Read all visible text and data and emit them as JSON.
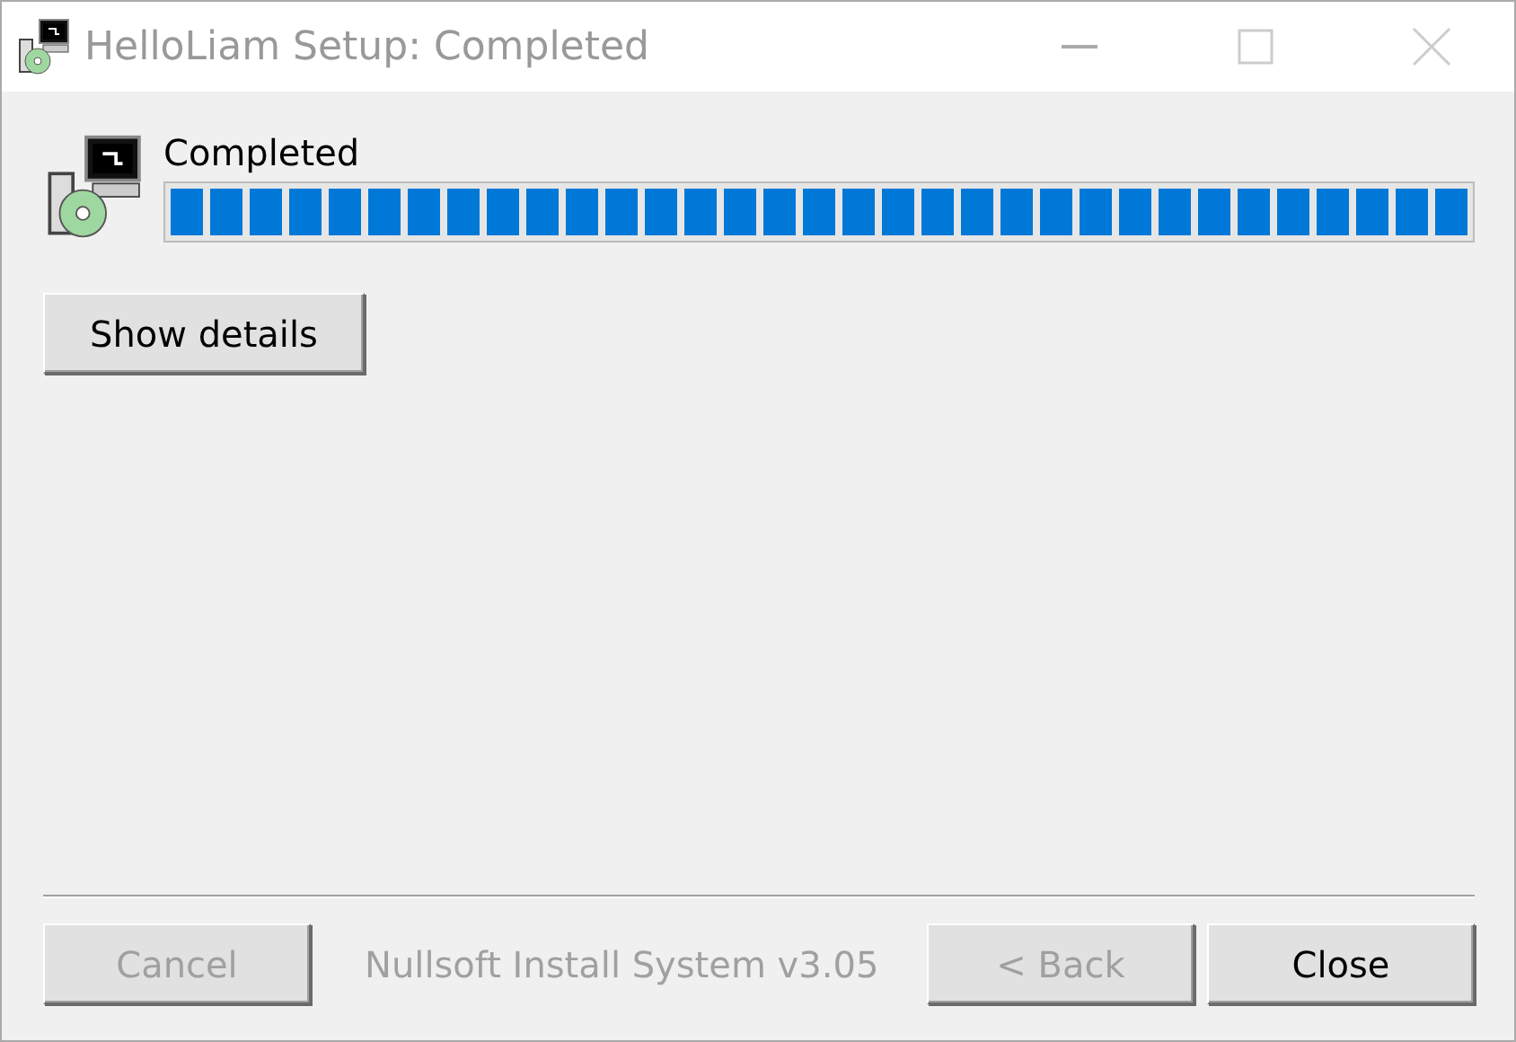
{
  "window": {
    "title": "HelloLiam Setup: Completed",
    "active": false
  },
  "status": {
    "label": "Completed"
  },
  "progress": {
    "level": 1
  },
  "details_button": {
    "label": "Show details",
    "disabled": false
  },
  "branding": {
    "text": "Nullsoft Install System v3.05"
  },
  "buttons": [
    {
      "label": "Cancel",
      "disabled": true
    },
    {
      "label": "< Back",
      "disabled": true
    },
    {
      "label": "Close",
      "disabled": false
    }
  ]
}
